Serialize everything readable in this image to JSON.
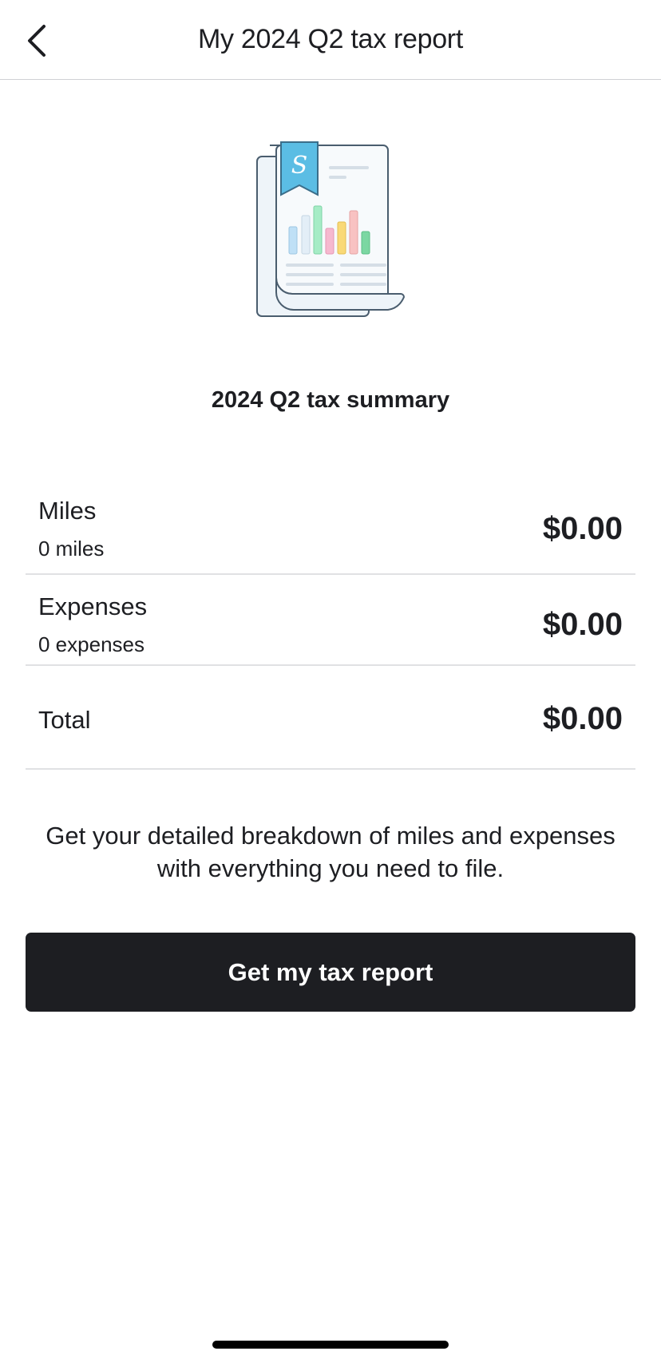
{
  "header": {
    "title": "My 2024 Q2 tax report",
    "back_icon": "chevron-left-icon"
  },
  "illustration": {
    "icon": "tax-report-document-icon",
    "badge_letter": "S",
    "colors": {
      "outline": "#4a5d6e",
      "paper": "#f7fafc",
      "paper_back": "#eef4f9",
      "badge": "#5bbde4",
      "bars": [
        "#bfe0f6",
        "#e3eef7",
        "#a6ecc6",
        "#f6b9cf",
        "#f9d977",
        "#f8c2c2",
        "#7bd7a2"
      ]
    }
  },
  "summary": {
    "title": "2024 Q2 tax summary",
    "rows": [
      {
        "label": "Miles",
        "sublabel": "0 miles",
        "amount": "$0.00"
      },
      {
        "label": "Expenses",
        "sublabel": "0 expenses",
        "amount": "$0.00"
      }
    ],
    "total": {
      "label": "Total",
      "amount": "$0.00"
    }
  },
  "description": "Get your detailed breakdown of miles and expenses with everything you need to file.",
  "cta": {
    "label": "Get my tax report",
    "color": "#1d1e22"
  }
}
